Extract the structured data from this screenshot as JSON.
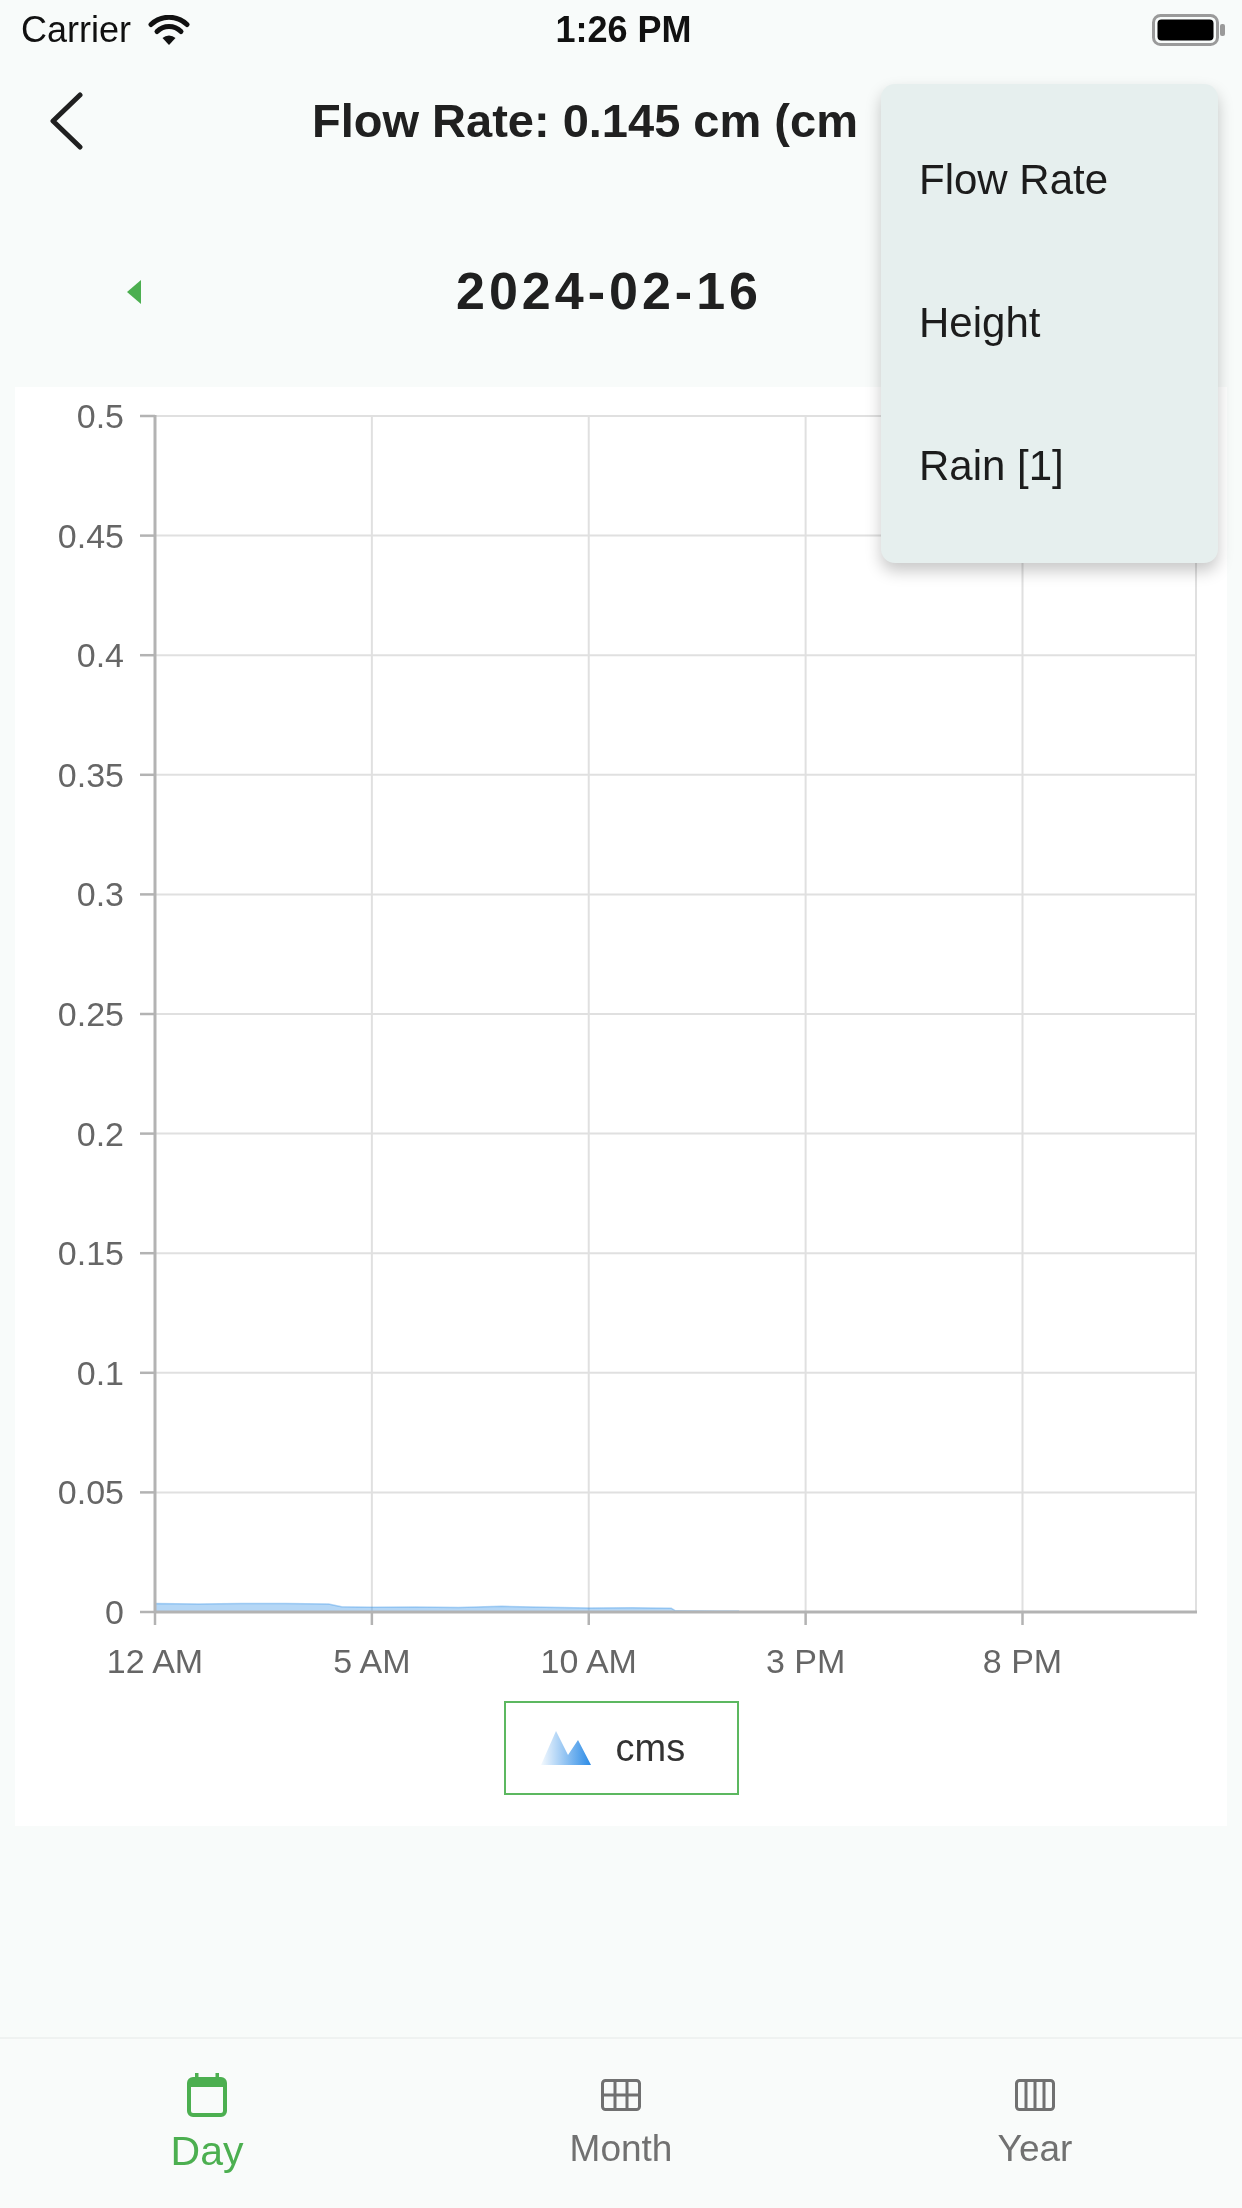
{
  "status_bar": {
    "carrier": "Carrier",
    "time": "1:26 PM"
  },
  "header": {
    "title": "Flow Rate: 0.145 cm (cm"
  },
  "dropdown_menu": {
    "items": [
      "Flow Rate",
      "Height",
      "Rain [1]"
    ]
  },
  "date_nav": {
    "date": "2024-02-16"
  },
  "chart": {
    "chart_data": {
      "type": "area",
      "grid": true,
      "x": [
        "2024-02-16T00:00",
        "2024-02-16T01:00",
        "2024-02-16T02:00",
        "2024-02-16T03:00",
        "2024-02-16T04:00",
        "2024-02-16T04:18",
        "2024-02-16T05:00",
        "2024-02-16T06:00",
        "2024-02-16T07:00",
        "2024-02-16T08:00",
        "2024-02-16T09:00",
        "2024-02-16T10:00",
        "2024-02-16T11:00",
        "2024-02-16T11:54",
        "2024-02-16T12:00",
        "2024-02-16T13:00",
        "2024-02-16T13:27"
      ],
      "series": [
        {
          "name": "cms",
          "color": "#2b8be6",
          "values": [
            0.0035,
            0.0034,
            0.0035,
            0.0035,
            0.0034,
            0.0022,
            0.002,
            0.0021,
            0.0019,
            0.0024,
            0.002,
            0.0017,
            0.0018,
            0.0016,
            0.0005,
            0.0004,
            0.0004
          ]
        }
      ],
      "xlim": [
        "2024-02-16T00:00",
        "2024-02-17T00:00"
      ],
      "ylim": [
        0,
        0.5
      ],
      "xticks": [
        {
          "value": "2024-02-16T00:00",
          "label": "12 AM"
        },
        {
          "value": "2024-02-16T05:00",
          "label": "5 AM"
        },
        {
          "value": "2024-02-16T10:00",
          "label": "10 AM"
        },
        {
          "value": "2024-02-16T15:00",
          "label": "3 PM"
        },
        {
          "value": "2024-02-16T20:00",
          "label": "8 PM"
        }
      ],
      "yticks": [
        0,
        0.05,
        0.1,
        0.15,
        0.2,
        0.25,
        0.3,
        0.35,
        0.4,
        0.45,
        0.5
      ]
    }
  },
  "tab_bar": {
    "tabs": [
      {
        "label": "Day",
        "selected": true
      },
      {
        "label": "Month",
        "selected": false
      },
      {
        "label": "Year",
        "selected": false
      }
    ]
  }
}
